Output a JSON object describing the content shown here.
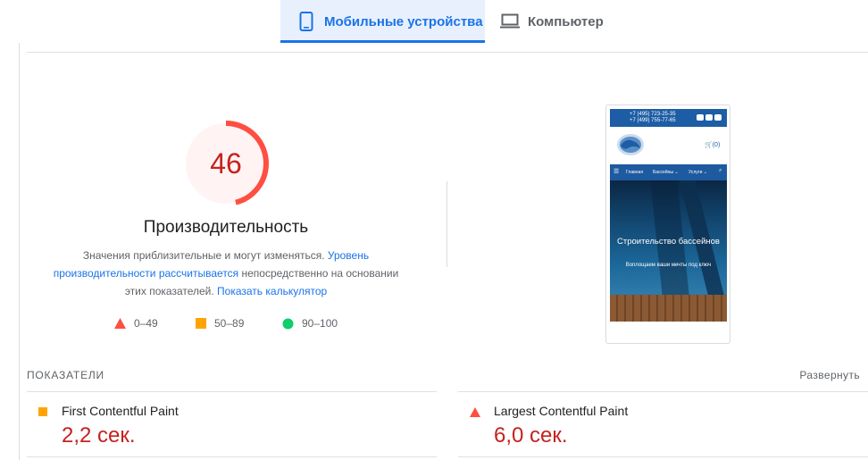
{
  "tabs": {
    "mobile": {
      "label": "Мобильные устройства",
      "icon": "smartphone-icon",
      "active": true
    },
    "desktop": {
      "label": "Компьютер",
      "icon": "laptop-icon",
      "active": false
    }
  },
  "score": {
    "value": "46",
    "fraction": 0.46,
    "title": "Производительность",
    "color": "#ff4e42"
  },
  "description": {
    "part1": "Значения приблизительные и могут изменяться. ",
    "link1": "Уровень производительности рассчитывается",
    "part2": " непосредственно на основании этих показателей. ",
    "link2": "Показать калькулятор"
  },
  "legend": [
    {
      "label": "0–49",
      "icon": "triangle-red-icon",
      "color": "#ff4e42"
    },
    {
      "label": "50–89",
      "icon": "square-orange-icon",
      "color": "#ffa400"
    },
    {
      "label": "90–100",
      "icon": "circle-green-icon",
      "color": "#0cce6b"
    }
  ],
  "preview": {
    "phone1": "+7 (495) 723-25-35",
    "phone2": "+7 (499) 755-77-65",
    "cart": "(0)",
    "nav": [
      "Главная",
      "Бассейны ⌄",
      "Услуги ⌄"
    ],
    "heading": "Строительство бассейнов",
    "subheading": "Воплощаем ваши мечты под ключ"
  },
  "metrics_header": "ПОКАЗАТЕЛИ",
  "expand_label": "Развернуть",
  "metrics": [
    {
      "name": "First Contentful Paint",
      "value": "2,2 сек.",
      "icon": "square-orange-icon",
      "color": "#ffa400"
    },
    {
      "name": "Largest Contentful Paint",
      "value": "6,0 сек.",
      "icon": "triangle-red-icon",
      "color": "#ff4e42"
    }
  ]
}
